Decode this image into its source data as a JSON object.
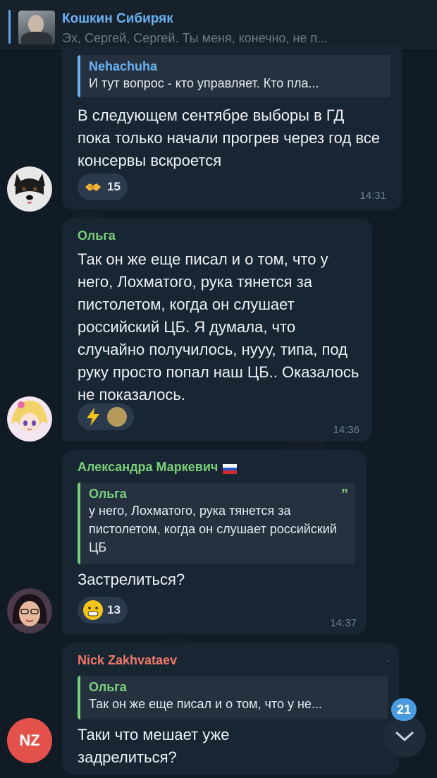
{
  "pinned": {
    "name": "Кошкин Сибиряк",
    "preview": "Эх, Сергей, Сергей. Ты меня, конечно, не п..."
  },
  "messages": [
    {
      "reply": {
        "name": "Nehachuha",
        "text": "И тут вопрос - кто управляет. Кто пла..."
      },
      "text": "В следующем сентябре выборы в ГД пока только начали прогрев через год все консервы вскроется",
      "reaction": {
        "emoji": "handshake-icon",
        "count": "15"
      },
      "time": "14:31"
    },
    {
      "sender": "Ольга",
      "text": "Так он же еще писал и о том, что у него, Лохматого, рука тянется за пистолетом, когда он слушает российский ЦБ. Я думала, что случайно получилось, нууу, типа, под руку просто попал наш ЦБ.. Оказалось не показалось.",
      "reaction": {
        "emoji": "lightning-icon",
        "count": ""
      },
      "time": "14:36"
    },
    {
      "sender": "Александра Маркевич",
      "reply": {
        "name": "Ольга",
        "text": "у него, Лохматого, рука тянется за пистолетом, когда он слушает российский ЦБ"
      },
      "text": "Застрелиться?",
      "reaction": {
        "emoji": "grinning-icon",
        "count": "13"
      },
      "time": "14:37"
    },
    {
      "sender": "Nick Zakhvataev",
      "avatar_initials": "NZ",
      "reply": {
        "name": "Ольга",
        "text": "Так он же еще писал и о том, что у не..."
      },
      "text": "Таки что мешает уже задрелиться?"
    }
  ],
  "unread_badge": "21",
  "colors": {
    "accent": "#6ab2f2",
    "olga": "#7ad07a",
    "aleksandra": "#7ad07a",
    "nick": "#f07a6a",
    "bubble": "#182533"
  }
}
